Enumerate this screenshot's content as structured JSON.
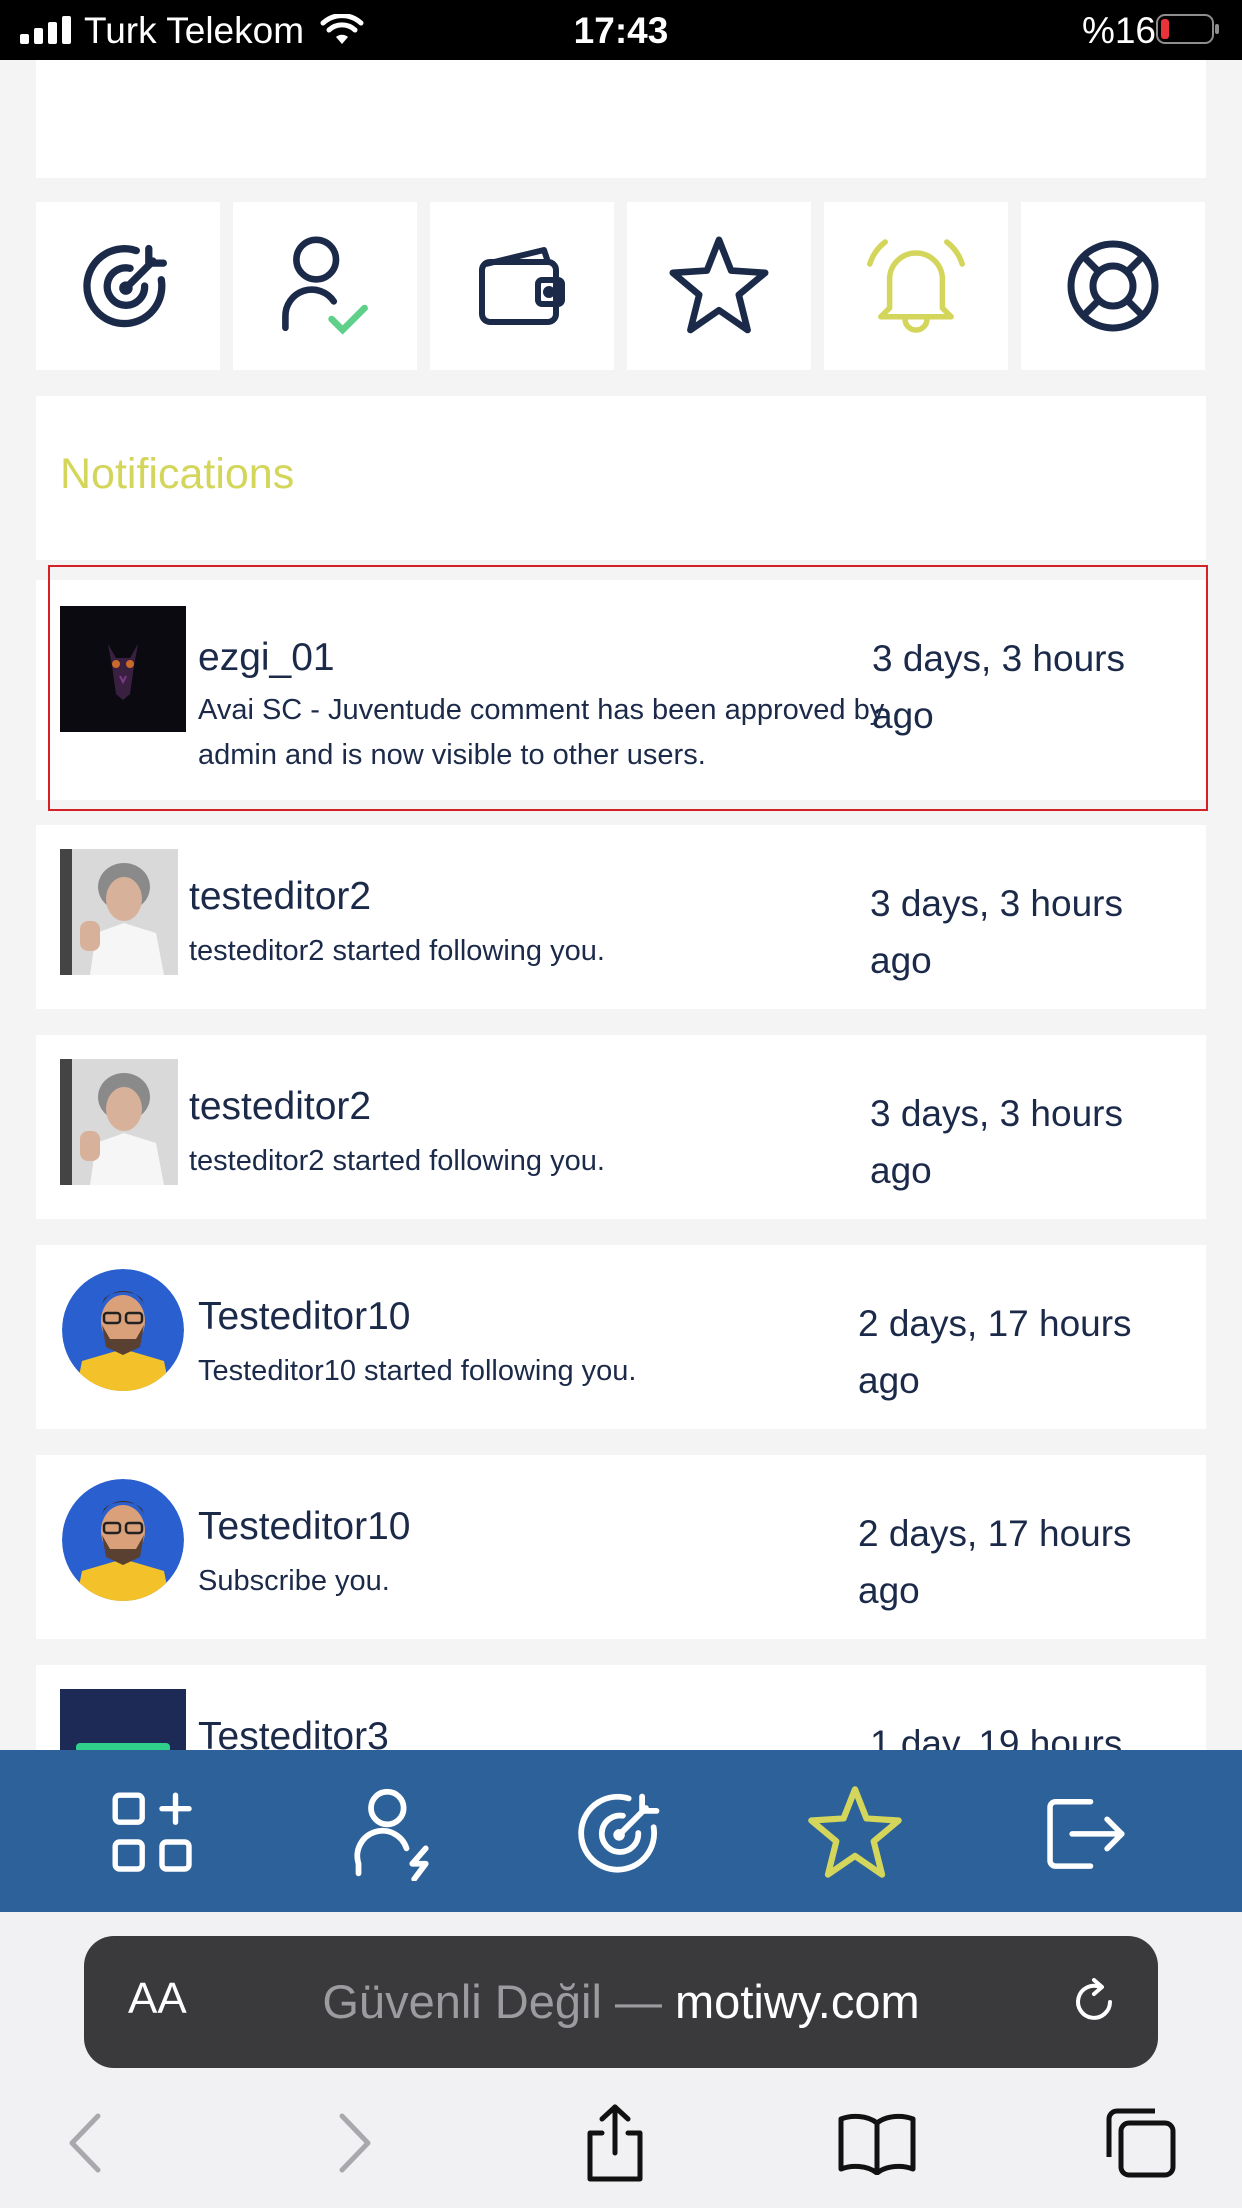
{
  "status_bar": {
    "carrier": "Turk Telekom",
    "time": "17:43",
    "battery": "%16"
  },
  "quick_tiles": [
    {
      "icon": "target-icon",
      "color": "#1c2a4a"
    },
    {
      "icon": "user-check-icon",
      "color": "#1c2a4a"
    },
    {
      "icon": "wallet-icon",
      "color": "#1c2a4a"
    },
    {
      "icon": "star-icon",
      "color": "#1c2a4a"
    },
    {
      "icon": "bell-icon",
      "color": "#d3d65a"
    },
    {
      "icon": "lifebuoy-icon",
      "color": "#1c2a4a"
    }
  ],
  "notifications": {
    "title": "Notifications",
    "items": [
      {
        "name": "ezgi_01",
        "message": "Avai SC - Juventude comment has been approved by admin and is now visible to other users.",
        "time": "3 days, 3 hours ago",
        "avatar": "owl-avatar"
      },
      {
        "name": "testeditor2",
        "message": "testeditor2 started following you.",
        "time": "3 days, 3 hours ago",
        "avatar": "woman-avatar"
      },
      {
        "name": "testeditor2",
        "message": "testeditor2 started following you.",
        "time": "3 days, 3 hours ago",
        "avatar": "woman-avatar"
      },
      {
        "name": "Testeditor10",
        "message": "Testeditor10 started following you.",
        "time": "2 days, 17 hours ago",
        "avatar": "man-avatar"
      },
      {
        "name": "Testeditor10",
        "message": "Subscribe you.",
        "time": "2 days, 17 hours ago",
        "avatar": "man-avatar"
      },
      {
        "name": "Testeditor3",
        "message": "",
        "time": "1 day, 19 hours",
        "avatar": "motiwy-logo"
      }
    ]
  },
  "app_nav": [
    {
      "icon": "grid-add-icon"
    },
    {
      "icon": "user-bolt-icon"
    },
    {
      "icon": "target-icon"
    },
    {
      "icon": "star-icon",
      "active": true
    },
    {
      "icon": "logout-icon"
    }
  ],
  "browser": {
    "aa_label": "AA",
    "insecure_label": "Güvenli Değil —",
    "domain": "motiwy.com"
  },
  "colors": {
    "navy": "#1c2a4a",
    "accent": "#d3d65a",
    "nav_bg": "#2c6199",
    "highlight": "#d42027"
  }
}
